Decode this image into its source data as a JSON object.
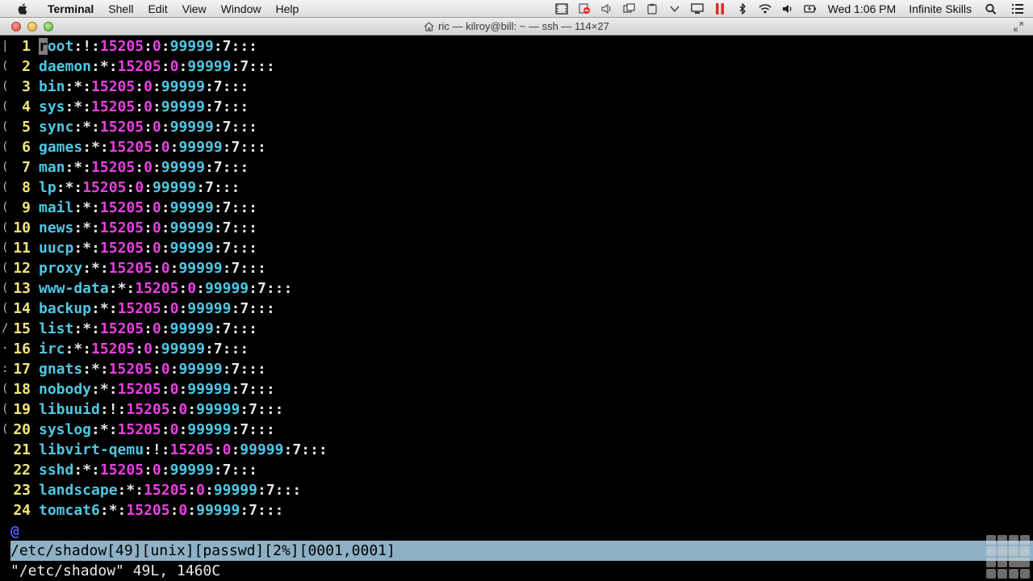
{
  "menubar": {
    "app_name": "Terminal",
    "items": [
      "Shell",
      "Edit",
      "View",
      "Window",
      "Help"
    ],
    "clock": "Wed 1:06 PM",
    "user": "Infinite Skills"
  },
  "window": {
    "title": "ric — kilroy@bill: ~ — ssh — 114×27"
  },
  "terminal": {
    "lines": [
      {
        "num": "1",
        "user": "root",
        "pw": "!"
      },
      {
        "num": "2",
        "user": "daemon",
        "pw": "*"
      },
      {
        "num": "3",
        "user": "bin",
        "pw": "*"
      },
      {
        "num": "4",
        "user": "sys",
        "pw": "*"
      },
      {
        "num": "5",
        "user": "sync",
        "pw": "*"
      },
      {
        "num": "6",
        "user": "games",
        "pw": "*"
      },
      {
        "num": "7",
        "user": "man",
        "pw": "*"
      },
      {
        "num": "8",
        "user": "lp",
        "pw": "*"
      },
      {
        "num": "9",
        "user": "mail",
        "pw": "*"
      },
      {
        "num": "10",
        "user": "news",
        "pw": "*"
      },
      {
        "num": "11",
        "user": "uucp",
        "pw": "*"
      },
      {
        "num": "12",
        "user": "proxy",
        "pw": "*"
      },
      {
        "num": "13",
        "user": "www-data",
        "pw": "*"
      },
      {
        "num": "14",
        "user": "backup",
        "pw": "*"
      },
      {
        "num": "15",
        "user": "list",
        "pw": "*"
      },
      {
        "num": "16",
        "user": "irc",
        "pw": "*"
      },
      {
        "num": "17",
        "user": "gnats",
        "pw": "*"
      },
      {
        "num": "18",
        "user": "nobody",
        "pw": "*"
      },
      {
        "num": "19",
        "user": "libuuid",
        "pw": "!"
      },
      {
        "num": "20",
        "user": "syslog",
        "pw": "*"
      },
      {
        "num": "21",
        "user": "libvirt-qemu",
        "pw": "!"
      },
      {
        "num": "22",
        "user": "sshd",
        "pw": "*"
      },
      {
        "num": "23",
        "user": "landscape",
        "pw": "*"
      },
      {
        "num": "24",
        "user": "tomcat6",
        "pw": "*"
      }
    ],
    "lastchg": "15205",
    "min": "0",
    "max": "99999",
    "warn": "7",
    "trail": ":::",
    "cont_marker": "@",
    "statusline": "/etc/shadow[49][unix][passwd][2%][0001,0001]",
    "cmdline": "\"/etc/shadow\" 49L, 1460C",
    "gutter_marks": [
      "|",
      "(",
      "(",
      "(",
      "(",
      "(",
      "(",
      "(",
      "(",
      "(",
      "(",
      "(",
      "(",
      "(",
      "/",
      "·",
      ":",
      "(",
      "(",
      "(",
      "",
      "",
      "",
      ""
    ]
  }
}
